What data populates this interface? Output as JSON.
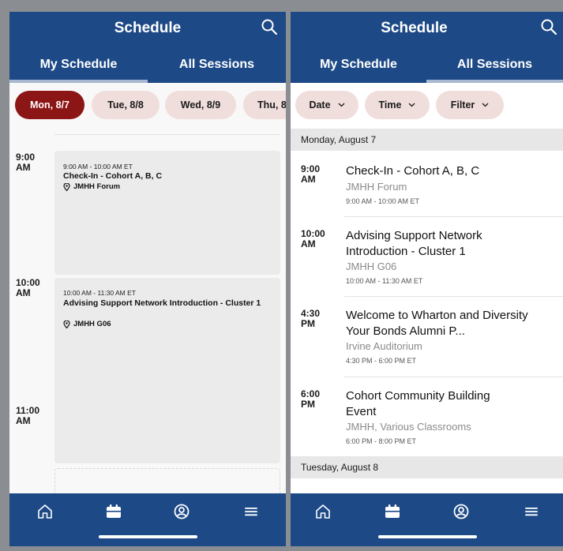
{
  "left": {
    "header": {
      "title": "Schedule",
      "search_icon": "search-icon"
    },
    "tabs": [
      {
        "label": "My Schedule",
        "active": true
      },
      {
        "label": "All Sessions",
        "active": false
      }
    ],
    "dates": [
      {
        "label": "Mon, 8/7",
        "active": true
      },
      {
        "label": "Tue, 8/8"
      },
      {
        "label": "Wed, 8/9"
      },
      {
        "label": "Thu, 8"
      }
    ],
    "time_labels": [
      "9:00\nAM",
      "10:00\nAM",
      "11:00\nAM"
    ],
    "events": [
      {
        "time": "9:00 AM - 10:00 AM ET",
        "name": "Check-In - Cohort A, B, C",
        "location": "JMHH Forum"
      },
      {
        "time": "10:00 AM - 11:30 AM ET",
        "name": "Advising Support Network Introduction - Cluster 1",
        "location": "JMHH G06"
      }
    ]
  },
  "right": {
    "header": {
      "title": "Schedule",
      "search_icon": "search-icon"
    },
    "tabs": [
      {
        "label": "My Schedule",
        "active": false
      },
      {
        "label": "All Sessions",
        "active": true
      }
    ],
    "filters": [
      {
        "label": "Date"
      },
      {
        "label": "Time"
      },
      {
        "label": "Filter"
      }
    ],
    "days": [
      {
        "label": "Monday, August 7"
      },
      {
        "label": "Tuesday, August 8"
      }
    ],
    "sessions": [
      {
        "start": "9:00\nAM",
        "name": "Check-In - Cohort A, B, C",
        "location": "JMHH Forum",
        "times": "9:00 AM - 10:00 AM ET"
      },
      {
        "start": "10:00\nAM",
        "name": "Advising Support Network Introduction - Cluster 1",
        "location": "JMHH G06",
        "times": "10:00 AM - 11:30 AM ET"
      },
      {
        "start": "4:30\nPM",
        "name": "Welcome to Wharton and Diversity Your Bonds Alumni P...",
        "location": "Irvine Auditorium",
        "times": "4:30 PM - 6:00 PM ET"
      },
      {
        "start": "6:00\nPM",
        "name": "Cohort Community Building Event",
        "location": "JMHH, Various Classrooms",
        "times": "6:00 PM - 8:00 PM ET"
      }
    ]
  },
  "bottom_nav": [
    {
      "icon": "home-icon"
    },
    {
      "icon": "calendar-icon",
      "active": true
    },
    {
      "icon": "profile-icon"
    },
    {
      "icon": "menu-icon"
    }
  ],
  "colors": {
    "brand_navy": "#1d4a86",
    "active_date": "#8c1515",
    "chip_bg": "#f0dedc"
  }
}
